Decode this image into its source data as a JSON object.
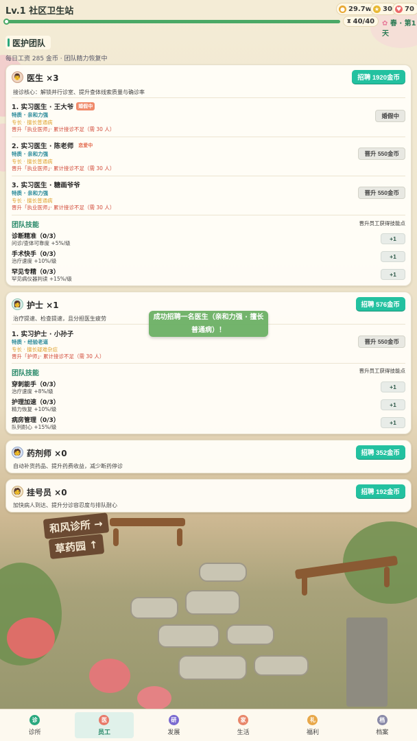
{
  "header": {
    "title": "Lv.1 社区卫生站",
    "coins": "29.7w",
    "stars": "30",
    "hearts": "70",
    "progress_text": "40/40",
    "progress_fraction": 1.0,
    "season": "春 · 第1天"
  },
  "section": {
    "title": "医护团队",
    "subtitle": "每日工资 285 金币 · 团队精力恢复中"
  },
  "doctor_card": {
    "title": "医生 ×3",
    "recruit_label": "招聘 1920金币",
    "desc": "接诊核心：解锁并行诊室、提升查体线索质量与确诊率",
    "members": [
      {
        "name": "1. 实习医生 · 王大爷",
        "tag": "婚假中",
        "trait": "特质 · 亲和力强",
        "spec": "专长 · 擅长普通病",
        "promo": "晋升「执业医师」· 累计接诊不足（需 30 人）",
        "button": "婚假中"
      },
      {
        "name": "2. 实习医生 · 陈老师",
        "tag": "恋爱中",
        "trait": "特质 · 亲和力强",
        "spec": "专长 · 擅长普通病",
        "promo": "晋升「执业医师」· 累计接诊不足（需 30 人）",
        "button": "晋升 550金币"
      },
      {
        "name": "3. 实习医生 · 糖画爷爷",
        "tag": "",
        "trait": "特质 · 亲和力强",
        "spec": "专长 · 擅长普通病",
        "promo": "晋升「执业医师」· 累计接诊不足（需 30 人）",
        "button": "晋升 550金币"
      }
    ],
    "skills_title": "团队技能",
    "skills_hint": "晋升员工获得技能点",
    "skills": [
      {
        "name": "诊断精准（0/3）",
        "desc": "问诊/查体可靠度 +5%/级",
        "button": "+1"
      },
      {
        "name": "手术快手（0/3）",
        "desc": "治疗速度 +10%/级",
        "button": "+1"
      },
      {
        "name": "罕见专精（0/3）",
        "desc": "罕见病仪器判读 +15%/级",
        "button": "+1"
      }
    ]
  },
  "nurse_card": {
    "title": "护士 ×1",
    "recruit_label": "招聘 576金币",
    "desc": "治疗提速、检查提速，且分担医生疲劳",
    "members": [
      {
        "name": "1. 实习护士 · 小孙子",
        "trait": "特质 · 经验老道",
        "spec": "专长 · 擅长疑难杂症",
        "promo": "晋升「护师」· 累计接诊不足（需 30 人）",
        "button": "晋升 550金币"
      }
    ],
    "skills_title": "团队技能",
    "skills_hint": "晋升员工获得技能点",
    "skills": [
      {
        "name": "穿刺能手（0/3）",
        "desc": "治疗速度 +8%/级",
        "button": "+1"
      },
      {
        "name": "护理加速（0/3）",
        "desc": "精力恢复 +10%/级",
        "button": "+1"
      },
      {
        "name": "病房管理（0/3）",
        "desc": "队列耐心 +15%/级",
        "button": "+1"
      }
    ]
  },
  "pharmacist_card": {
    "title": "药剂师 ×0",
    "recruit_label": "招聘 352金币",
    "desc": "自动补货药品、提升药费收益，减少断药停诊"
  },
  "registrar_card": {
    "title": "挂号员 ×0",
    "recruit_label": "招聘 192金币",
    "desc": "加快病人到达、提升分诊容忍度与排队耐心"
  },
  "toast": "成功招聘一名医生（亲和力强 · 擅长普通病）！",
  "scene_signs": [
    "和风诊所 →",
    "草药园 ↑"
  ],
  "nav": [
    {
      "label": "诊所",
      "icon": "诊",
      "color": "#2aa87e"
    },
    {
      "label": "员工",
      "icon": "医",
      "color": "#e87a6a"
    },
    {
      "label": "发展",
      "icon": "研",
      "color": "#7a6ad0"
    },
    {
      "label": "生活",
      "icon": "家",
      "color": "#e8866a"
    },
    {
      "label": "福利",
      "icon": "礼",
      "color": "#e8a84a"
    },
    {
      "label": "档案",
      "icon": "档",
      "color": "#8a8aa8"
    }
  ],
  "active_nav": 1
}
